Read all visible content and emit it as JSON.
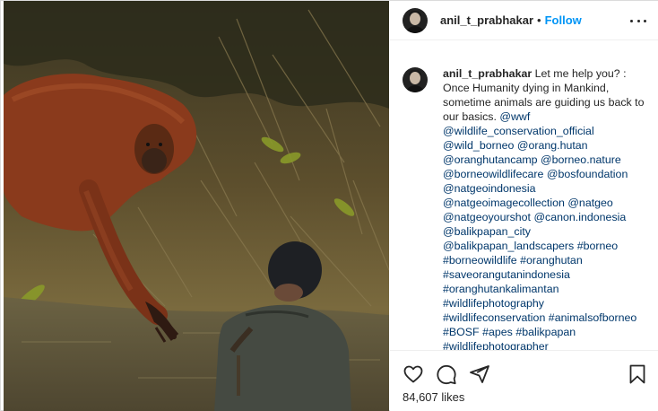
{
  "post": {
    "username": "anil_t_prabhakar",
    "separator": "•",
    "follow_label": "Follow",
    "image_alt": "Orangutan reaching out a hand to a man standing in river water",
    "caption_text": "Let me help you? : Once Humanity dying in Mankind, sometime animals are guiding us back to our basics.",
    "tags": [
      "@wwf",
      "@wildlife_conservation_official",
      "@wild_borneo",
      "@orang.hutan",
      "@oranghutancamp",
      "@borneo.nature",
      "@borneowildlifecare",
      "@bosfoundation",
      "@natgeoindonesia",
      "@natgeoimagecollection",
      "@natgeo",
      "@natgeoyourshot",
      "@canon.indonesia",
      "@balikpapan_city",
      "@balikpapan_landscapers",
      "#borneo",
      "#borneowildlife",
      "#oranghutan",
      "#saveorangutanindonesia",
      "#oranghutankalimantan",
      "#wildlifephotography",
      "#wildlifeconservation",
      "#animalsofborneo",
      "#BOSF",
      "#apes",
      "#balikpapan",
      "#wildlifephotographer"
    ],
    "likes_label": "84,607 likes"
  },
  "icons": {
    "like": "heart-icon",
    "comment": "comment-icon",
    "share": "share-icon",
    "save": "bookmark-icon",
    "more": "more-options-icon"
  },
  "colors": {
    "link_blue": "#0095f6",
    "tag_blue": "#00376b",
    "text": "#262626",
    "border": "#dbdbdb"
  }
}
